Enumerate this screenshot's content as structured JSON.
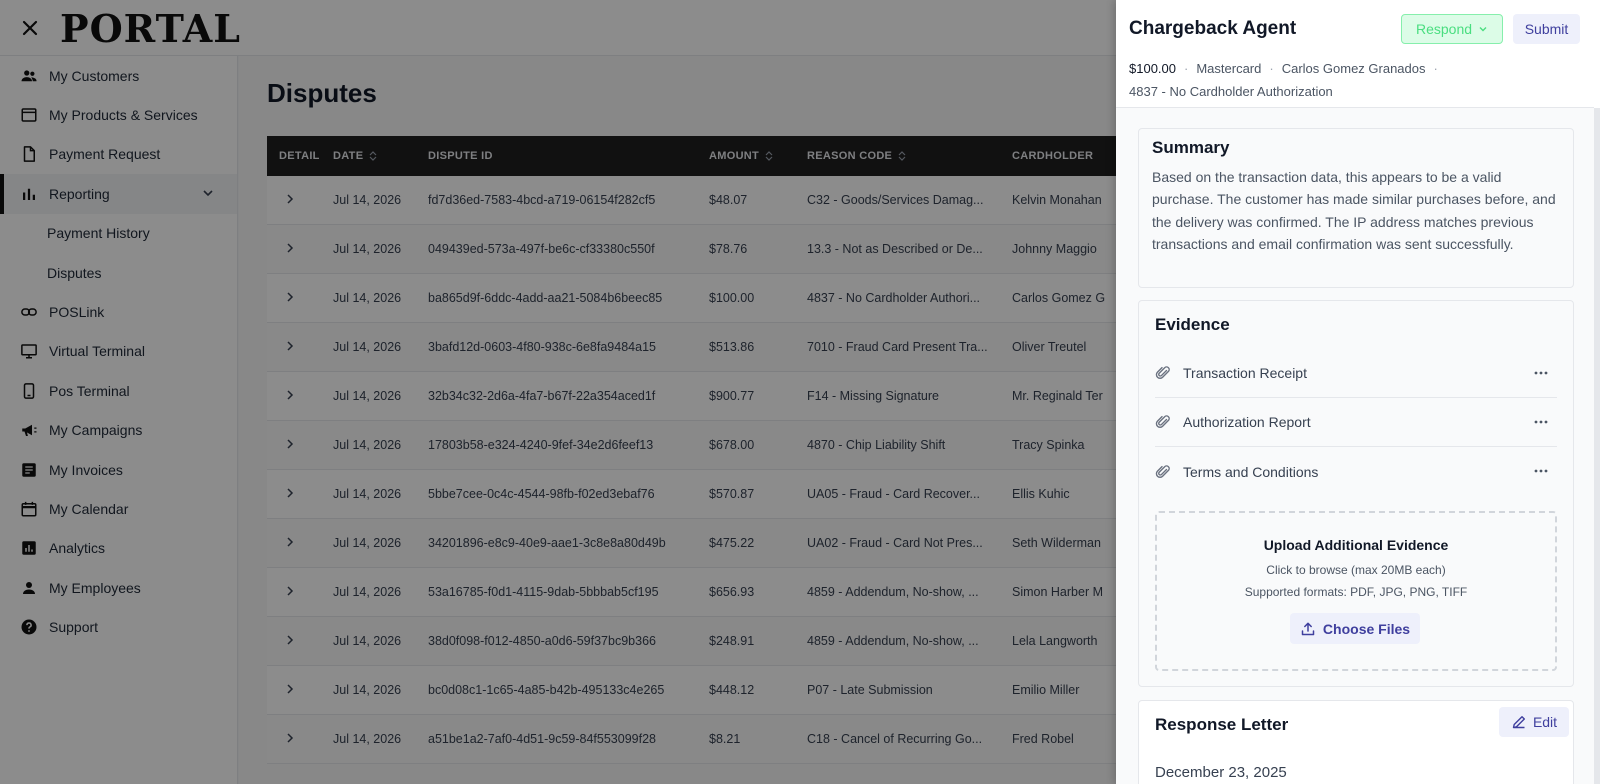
{
  "header": {
    "logo": "PORTAL"
  },
  "sidebar": {
    "items": [
      {
        "label": "My Customers",
        "icon": "people-icon"
      },
      {
        "label": "My Products & Services",
        "icon": "window-icon"
      },
      {
        "label": "Payment Request",
        "icon": "document-icon"
      },
      {
        "label": "Reporting",
        "icon": "bar-chart-icon"
      },
      {
        "label": "Payment History"
      },
      {
        "label": "Disputes"
      },
      {
        "label": "POSLink",
        "icon": "link-icon"
      },
      {
        "label": "Virtual Terminal",
        "icon": "monitor-icon"
      },
      {
        "label": "Pos Terminal",
        "icon": "phone-icon"
      },
      {
        "label": "My Campaigns",
        "icon": "megaphone-icon"
      },
      {
        "label": "My Invoices",
        "icon": "invoice-icon"
      },
      {
        "label": "My Calendar",
        "icon": "calendar-icon"
      },
      {
        "label": "Analytics",
        "icon": "analytics-icon"
      },
      {
        "label": "My Employees",
        "icon": "person-icon"
      },
      {
        "label": "Support",
        "icon": "help-icon"
      }
    ]
  },
  "main": {
    "title": "Disputes",
    "columns": [
      "DETAIL",
      "DATE",
      "DISPUTE ID",
      "AMOUNT",
      "REASON CODE",
      "CARDHOLDER"
    ],
    "rows": [
      {
        "date": "Jul 14, 2026",
        "id": "fd7d36ed-7583-4bcd-a719-06154f282cf5",
        "amount": "$48.07",
        "reason": "C32 - Goods/Services Damag...",
        "holder": "Kelvin Monahan"
      },
      {
        "date": "Jul 14, 2026",
        "id": "049439ed-573a-497f-be6c-cf33380c550f",
        "amount": "$78.76",
        "reason": "13.3 - Not as Described or De...",
        "holder": "Johnny Maggio"
      },
      {
        "date": "Jul 14, 2026",
        "id": "ba865d9f-6ddc-4add-aa21-5084b6beec85",
        "amount": "$100.00",
        "reason": "4837 - No Cardholder Authori...",
        "holder": "Carlos Gomez G"
      },
      {
        "date": "Jul 14, 2026",
        "id": "3bafd12d-0603-4f80-938c-6e8fa9484a15",
        "amount": "$513.86",
        "reason": "7010 - Fraud Card Present Tra...",
        "holder": "Oliver Treutel"
      },
      {
        "date": "Jul 14, 2026",
        "id": "32b34c32-2d6a-4fa7-b67f-22a354aced1f",
        "amount": "$900.77",
        "reason": "F14 - Missing Signature",
        "holder": "Mr. Reginald Ter"
      },
      {
        "date": "Jul 14, 2026",
        "id": "17803b58-e324-4240-9fef-34e2d6feef13",
        "amount": "$678.00",
        "reason": "4870 - Chip Liability Shift",
        "holder": "Tracy Spinka"
      },
      {
        "date": "Jul 14, 2026",
        "id": "5bbe7cee-0c4c-4544-98fb-f02ed3ebaf76",
        "amount": "$570.87",
        "reason": "UA05 - Fraud - Card Recover...",
        "holder": "Ellis Kuhic"
      },
      {
        "date": "Jul 14, 2026",
        "id": "34201896-e8c9-40e9-aae1-3c8e8a80d49b",
        "amount": "$475.22",
        "reason": "UA02 - Fraud - Card Not Pres...",
        "holder": "Seth Wilderman"
      },
      {
        "date": "Jul 14, 2026",
        "id": "53a16785-f0d1-4115-9dab-5bbbab5cf195",
        "amount": "$656.93",
        "reason": "4859 - Addendum, No-show, ...",
        "holder": "Simon Harber M"
      },
      {
        "date": "Jul 14, 2026",
        "id": "38d0f098-f012-4850-a0d6-59f37bc9b366",
        "amount": "$248.91",
        "reason": "4859 - Addendum, No-show, ...",
        "holder": "Lela Langworth"
      },
      {
        "date": "Jul 14, 2026",
        "id": "bc0d08c1-1c65-4a85-b42b-495133c4e265",
        "amount": "$448.12",
        "reason": "P07 - Late Submission",
        "holder": "Emilio Miller"
      },
      {
        "date": "Jul 14, 2026",
        "id": "a51be1a2-7af0-4d51-9c59-84f553099f28",
        "amount": "$8.21",
        "reason": "C18 - Cancel of Recurring Go...",
        "holder": "Fred Robel"
      }
    ]
  },
  "drawer": {
    "title": "Chargeback Agent",
    "respond_label": "Respond",
    "submit_label": "Submit",
    "amount": "$100.00",
    "network": "Mastercard",
    "cardholder": "Carlos Gomez Granados",
    "reason": "4837 - No Cardholder Authorization",
    "summary": {
      "title": "Summary",
      "text": "Based on the transaction data, this appears to be a valid purchase. The customer has made similar purchases before, and the delivery was confirmed. The IP address matches previous transactions and email confirmation was sent successfully."
    },
    "evidence": {
      "title": "Evidence",
      "items": [
        "Transaction Receipt",
        "Authorization Report",
        "Terms and Conditions"
      ],
      "upload_title": "Upload Additional Evidence",
      "upload_sub": "Click to browse (max 20MB each)",
      "upload_formats": "Supported formats: PDF, JPG, PNG, TIFF",
      "choose_label": "Choose Files"
    },
    "letter": {
      "title": "Response Letter",
      "edit_label": "Edit",
      "date": "December 23, 2025"
    }
  },
  "colors": {
    "accent": "#3f3f9e",
    "respond_green": "#4ade80",
    "header_dark": "#1f1f1f"
  }
}
